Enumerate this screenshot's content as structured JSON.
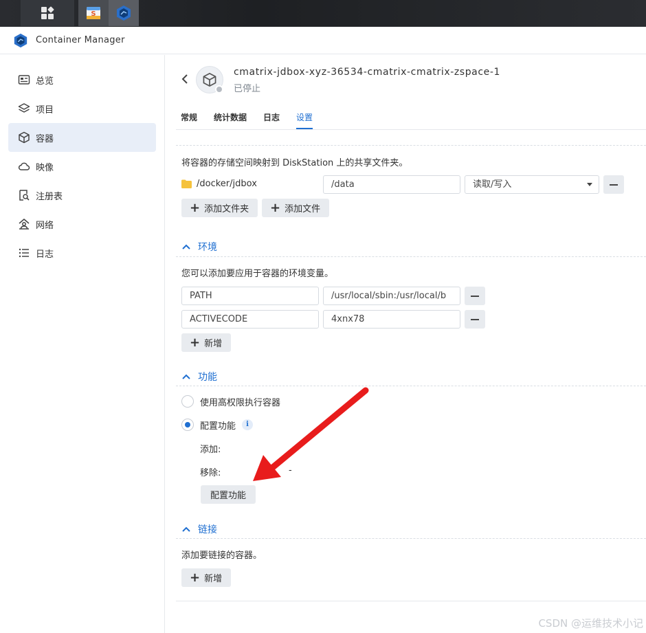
{
  "app": {
    "title": "Container Manager"
  },
  "sidebar": {
    "items": [
      {
        "label": "总览",
        "icon": "overview-icon"
      },
      {
        "label": "项目",
        "icon": "layers-icon"
      },
      {
        "label": "容器",
        "icon": "cube-icon",
        "active": true
      },
      {
        "label": "映像",
        "icon": "cloud-icon"
      },
      {
        "label": "注册表",
        "icon": "registry-search-icon"
      },
      {
        "label": "网络",
        "icon": "network-icon"
      },
      {
        "label": "日志",
        "icon": "list-icon"
      }
    ]
  },
  "header": {
    "title": "cmatrix-jdbox-xyz-36534-cmatrix-cmatrix-zspace-1",
    "status": "已停止"
  },
  "tabs": [
    {
      "label": "常规"
    },
    {
      "label": "统计数据"
    },
    {
      "label": "日志"
    },
    {
      "label": "设置",
      "active": true
    }
  ],
  "volumes": {
    "description": "将容器的存储空间映射到 DiskStation 上的共享文件夹。",
    "rows": [
      {
        "host_path": "/docker/jdbox",
        "mount_path": "/data",
        "mode": "读取/写入"
      }
    ],
    "add_folder_label": "添加文件夹",
    "add_file_label": "添加文件"
  },
  "environment": {
    "title": "环境",
    "description": "您可以添加要应用于容器的环境变量。",
    "rows": [
      {
        "name": "PATH",
        "value": "/usr/local/sbin:/usr/local/b"
      },
      {
        "name": "ACTIVECODE",
        "value": "4xnx78"
      }
    ],
    "add_label": "新增"
  },
  "capabilities": {
    "title": "功能",
    "option_privileged": "使用高权限执行容器",
    "option_configure": "配置功能",
    "selected": "configure",
    "add_label": "添加:",
    "remove_label": "移除:",
    "remove_value": "-",
    "configure_button": "配置功能"
  },
  "links": {
    "title": "链接",
    "description": "添加要链接的容器。",
    "add_label": "新增"
  },
  "watermark": "CSDN @运维技术小记",
  "colors": {
    "accent": "#1f6fd1",
    "arrow": "#e81c1c"
  }
}
